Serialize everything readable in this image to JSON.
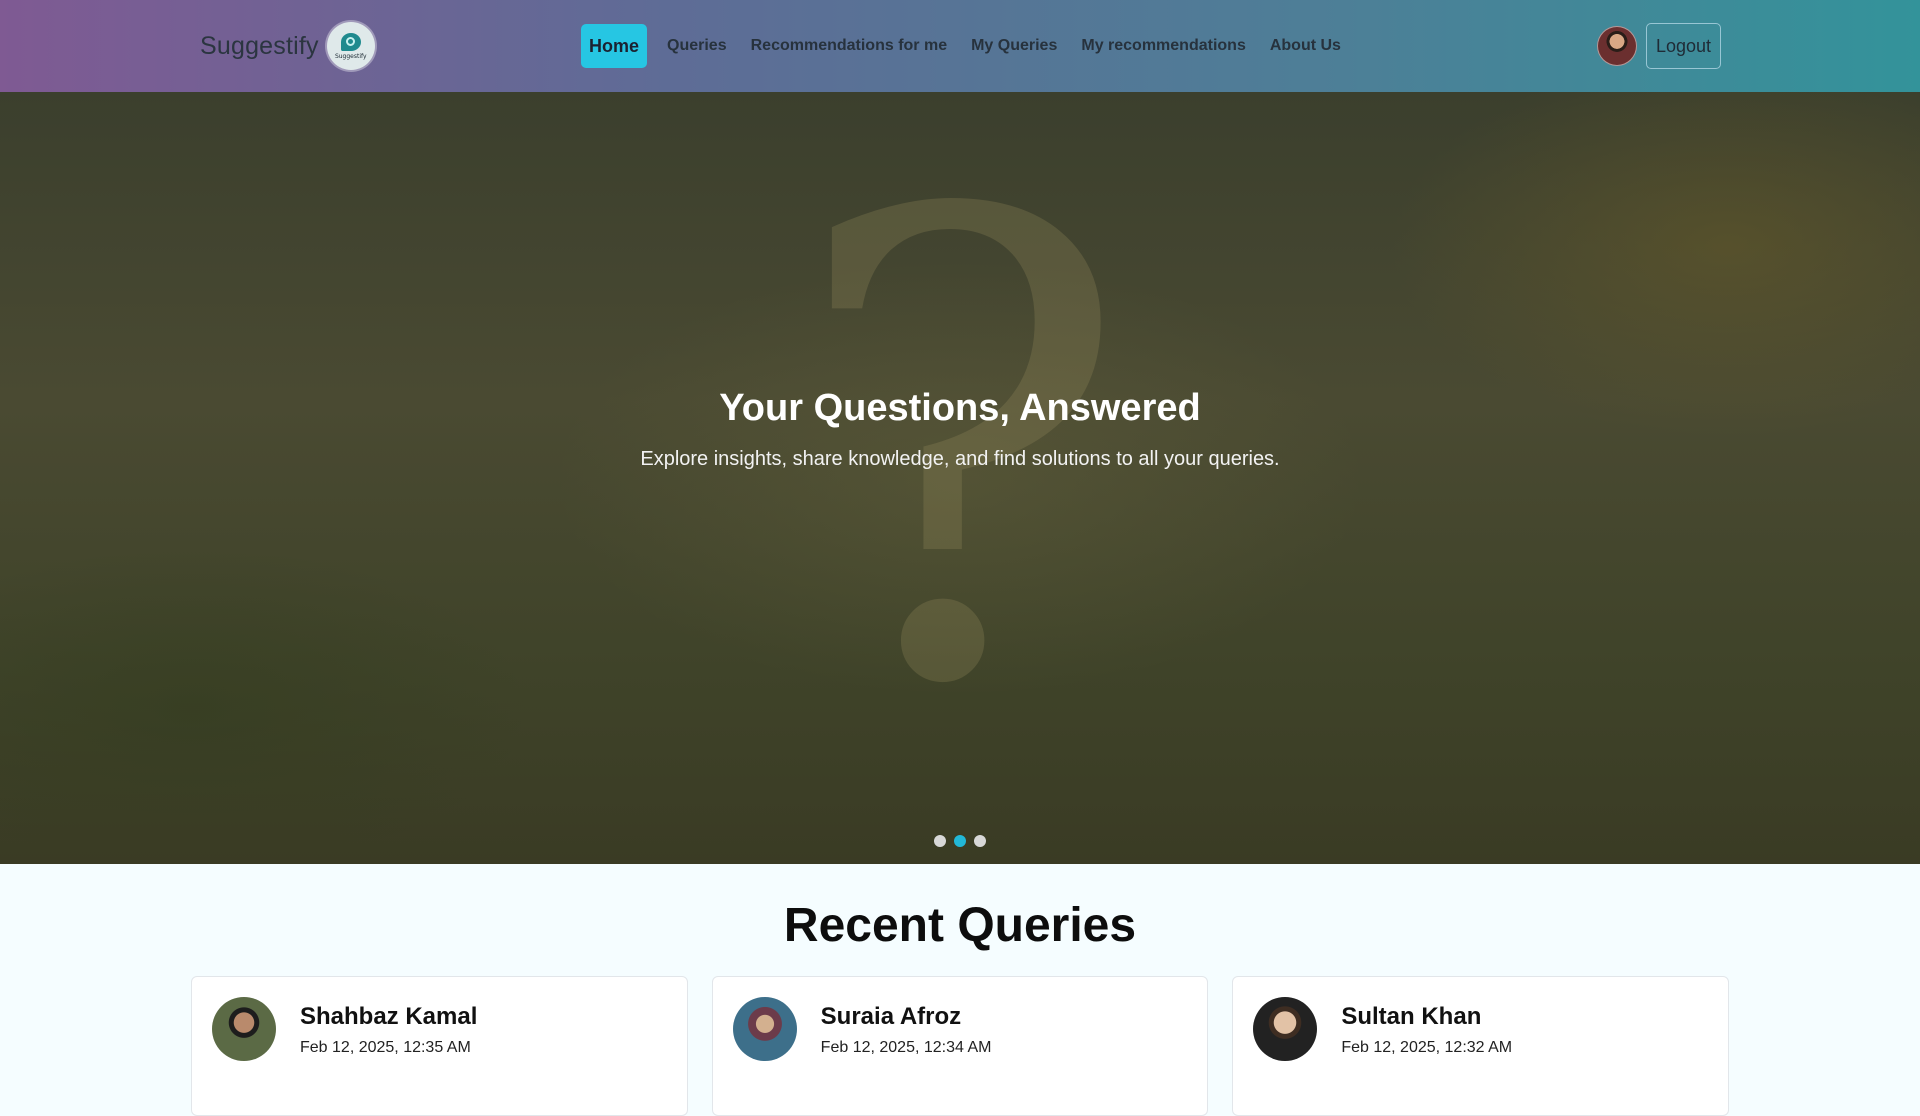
{
  "navbar": {
    "brand": "Suggestify",
    "logo_text": "Suggestify",
    "links": [
      {
        "label": "Home",
        "active": true
      },
      {
        "label": "Queries"
      },
      {
        "label": "Recommendations for me"
      },
      {
        "label": "My Queries"
      },
      {
        "label": "My recommendations"
      },
      {
        "label": "About Us"
      }
    ],
    "logout_label": "Logout",
    "accent_color": "#26c6e3"
  },
  "hero": {
    "title": "Your Questions, Answered",
    "subtitle": "Explore insights, share knowledge, and find solutions to all your queries.",
    "background_icon": "question-mark",
    "slides_count": 3,
    "active_slide": 2
  },
  "recent": {
    "title": "Recent Queries",
    "cards": [
      {
        "name": "Shahbaz Kamal",
        "date": "Feb 12, 2025, 12:35 AM"
      },
      {
        "name": "Suraia Afroz",
        "date": "Feb 12, 2025, 12:34 AM"
      },
      {
        "name": "Sultan Khan",
        "date": "Feb 12, 2025, 12:32 AM"
      }
    ]
  }
}
